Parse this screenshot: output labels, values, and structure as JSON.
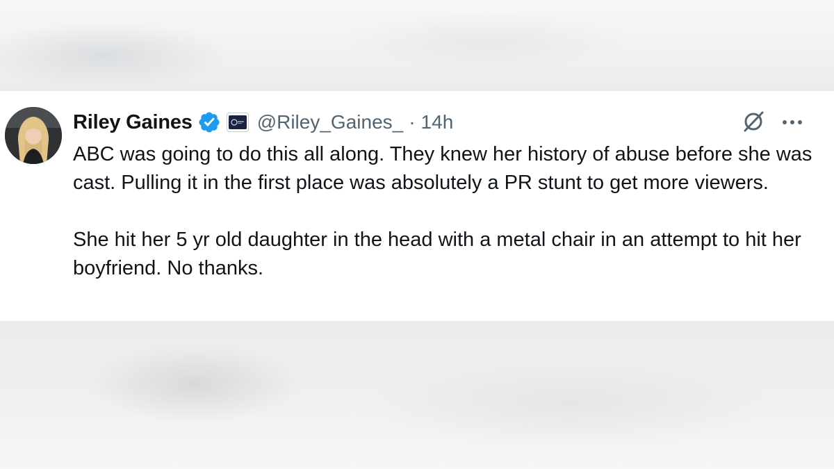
{
  "tweet": {
    "author_name": "Riley Gaines",
    "handle": "@Riley_Gaines_",
    "separator": "·",
    "time": "14h",
    "paragraphs": [
      "ABC was going to do this all along. They knew her history of abuse before she was cast. Pulling it in the first place was absolutely a PR stunt to get more viewers.",
      "She hit her 5 yr old daughter in the head with a metal chair in an attempt to hit her boyfriend. No thanks."
    ]
  },
  "icons": {
    "verified": "verified-badge-icon",
    "affiliate": "affiliate-badge-icon",
    "grok": "grok-icon",
    "more": "more-icon"
  },
  "colors": {
    "text_primary": "#0f1419",
    "text_secondary": "#536471",
    "verified_blue": "#1d9bf0",
    "background": "#ffffff"
  }
}
